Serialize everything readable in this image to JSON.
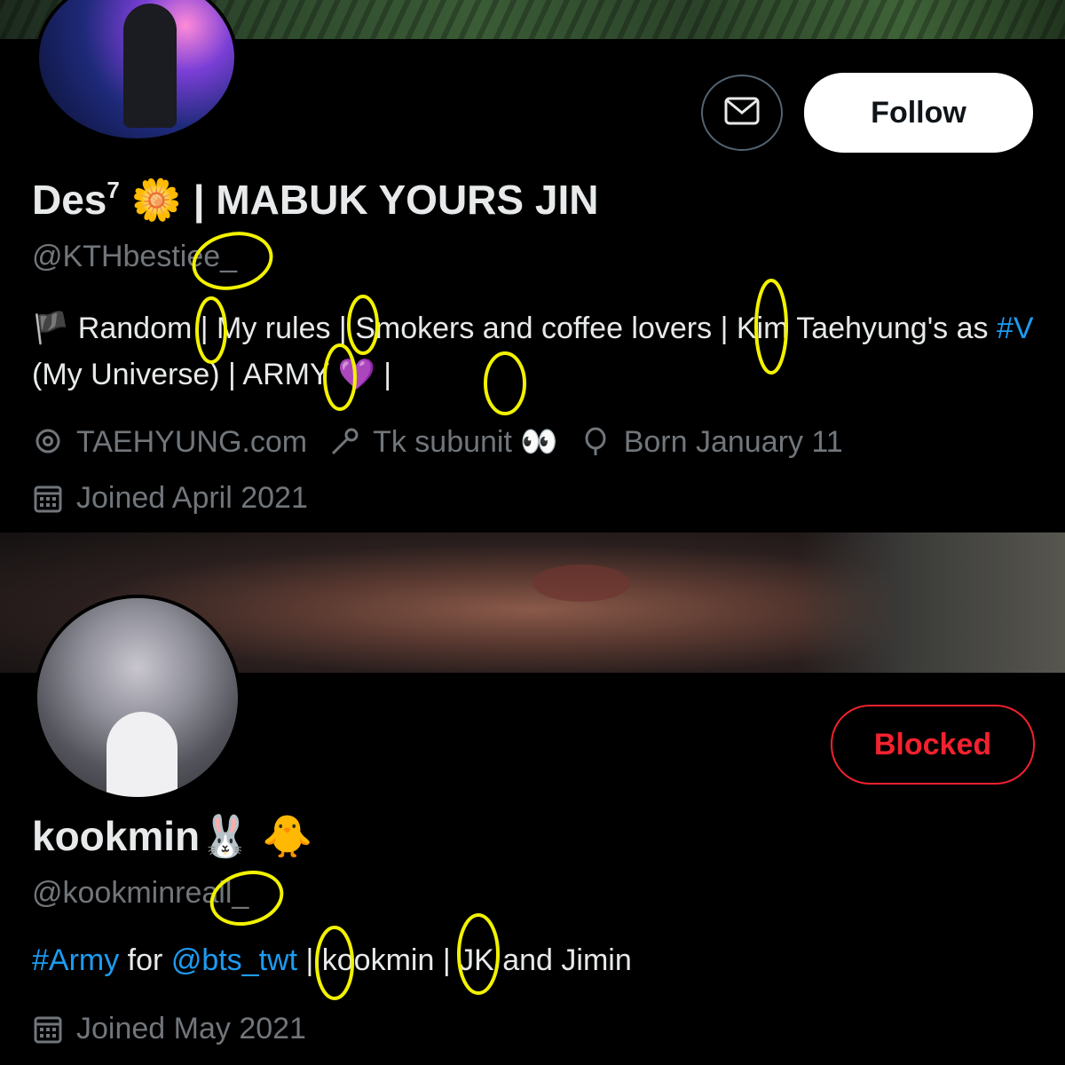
{
  "profiles": [
    {
      "display_name": "Des",
      "name_superscript": "7",
      "name_emoji": "🌼",
      "name_suffix": " | MABUK YOURS JIN",
      "handle": "@KTHbestiee_",
      "follow_label": "Follow",
      "bio": {
        "flag": "🏴",
        "t1": " Random | My rules | Smokers and coffee lovers | Kim Taehyung's as ",
        "hashtag": "#V",
        "t2": " (My Universe) | ARMY ",
        "heart": "💜",
        "t3": " |"
      },
      "location": "TAEHYUNG.com",
      "website": "Tk subunit 👀",
      "birthday": "Born January 11",
      "joined": "Joined April 2021"
    },
    {
      "display_name": "kookmin",
      "name_emoji": "🐰 🐥",
      "handle": "@kookminreall_",
      "blocked_label": "Blocked",
      "bio": {
        "hashtag": "#Army",
        "t1": " for ",
        "mention": "@bts_twt",
        "t2": " | kookmin | JK and  Jimin"
      },
      "joined": "Joined May 2021"
    }
  ],
  "colors": {
    "accent": "#1d9bf0",
    "blocked": "#f4212e",
    "annotation": "#f2f200",
    "muted": "#71767b"
  },
  "icons": [
    "mail-icon",
    "location-icon",
    "link-icon",
    "birthday-icon",
    "calendar-icon"
  ]
}
